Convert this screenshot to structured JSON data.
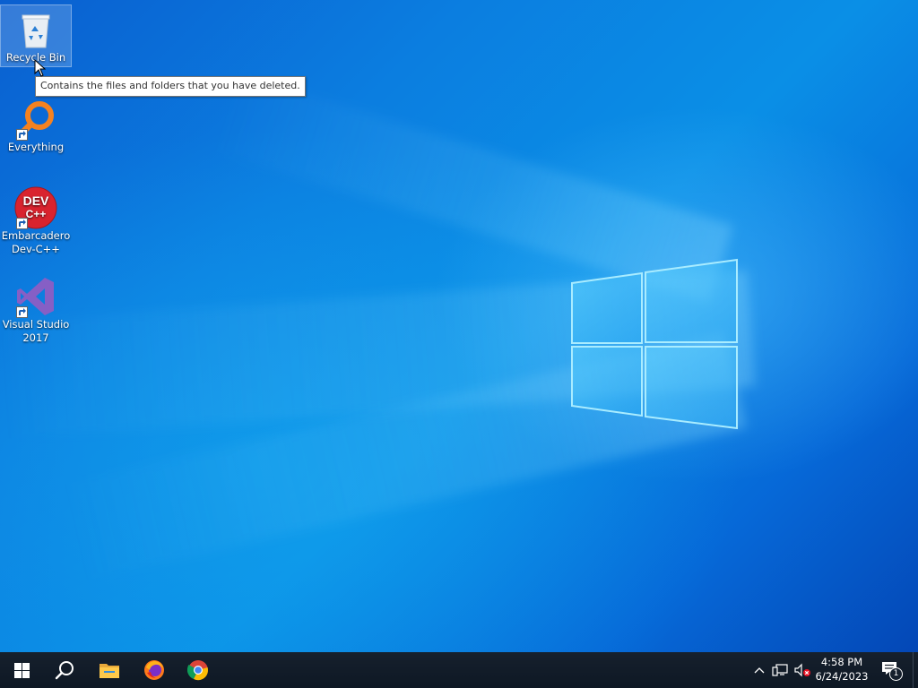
{
  "desktop": {
    "icons": [
      {
        "label": "Recycle Bin",
        "icon": "recycle-bin-icon",
        "selected": true
      },
      {
        "label": "Everything",
        "icon": "everything-search-icon",
        "selected": false
      },
      {
        "label": "Embarcadero Dev-C++",
        "icon": "dev-cpp-icon",
        "selected": false,
        "logo_text": "DEV C++"
      },
      {
        "label": "Visual Studio 2017",
        "icon": "visual-studio-icon",
        "selected": false
      }
    ],
    "tooltip": "Contains the files and folders that you have deleted."
  },
  "taskbar": {
    "buttons": [
      {
        "name": "start",
        "icon": "windows-logo-icon"
      },
      {
        "name": "search",
        "icon": "search-icon"
      },
      {
        "name": "file-explorer",
        "icon": "folder-icon"
      },
      {
        "name": "firefox",
        "icon": "firefox-icon"
      },
      {
        "name": "chrome",
        "icon": "chrome-icon"
      }
    ],
    "tray": {
      "icons": [
        "chevron-up-icon",
        "network-icon",
        "volume-muted-icon"
      ],
      "time": "4:58 PM",
      "date": "6/24/2023",
      "notification_count": "1"
    }
  },
  "colors": {
    "taskbar_bg": "#16202d",
    "desktop_blue": "#0a8fe6",
    "accent": "#0078d7"
  }
}
